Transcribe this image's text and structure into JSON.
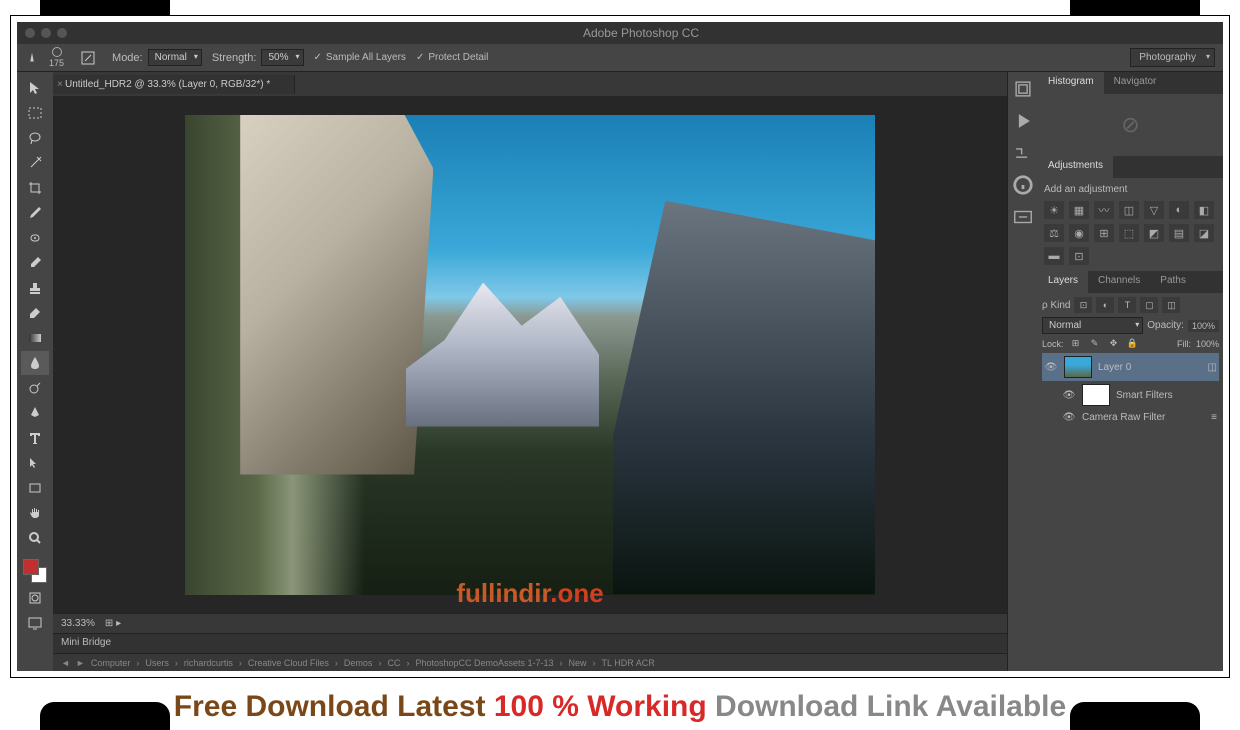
{
  "title": "Adobe Photoshop CC",
  "optbar": {
    "brush_size": "175",
    "mode_label": "Mode:",
    "mode_value": "Normal",
    "strength_label": "Strength:",
    "strength_value": "50%",
    "sample_all": "Sample All Layers",
    "protect_detail": "Protect Detail",
    "workspace": "Photography"
  },
  "doctab": {
    "label": "Untitled_HDR2 @ 33.3% (Layer 0, RGB/32*) *"
  },
  "status": {
    "zoom": "33.33%"
  },
  "minibridge": "Mini Bridge",
  "breadcrumb": [
    "Computer",
    "Users",
    "richardcurtis",
    "Creative Cloud Files",
    "Demos",
    "CC",
    "PhotoshopCC DemoAssets 1-7-13",
    "New",
    "TL HDR ACR"
  ],
  "panels": {
    "histogram": "Histogram",
    "navigator": "Navigator",
    "adjustments": "Adjustments",
    "add_adjustment": "Add an adjustment",
    "layers": "Layers",
    "channels": "Channels",
    "paths": "Paths",
    "kind": "ρ Kind",
    "blend": "Normal",
    "opacity_label": "Opacity:",
    "opacity_value": "100%",
    "lock_label": "Lock:",
    "fill_label": "Fill:",
    "fill_value": "100%",
    "layer0": "Layer 0",
    "smart_filters": "Smart Filters",
    "camera_raw": "Camera Raw Filter"
  },
  "watermark": {
    "p1": "fullindir",
    "p2": ".one"
  },
  "banner": {
    "b1": "Free Download Latest ",
    "b2": "100 % Working ",
    "b3": "Download Link Available"
  }
}
